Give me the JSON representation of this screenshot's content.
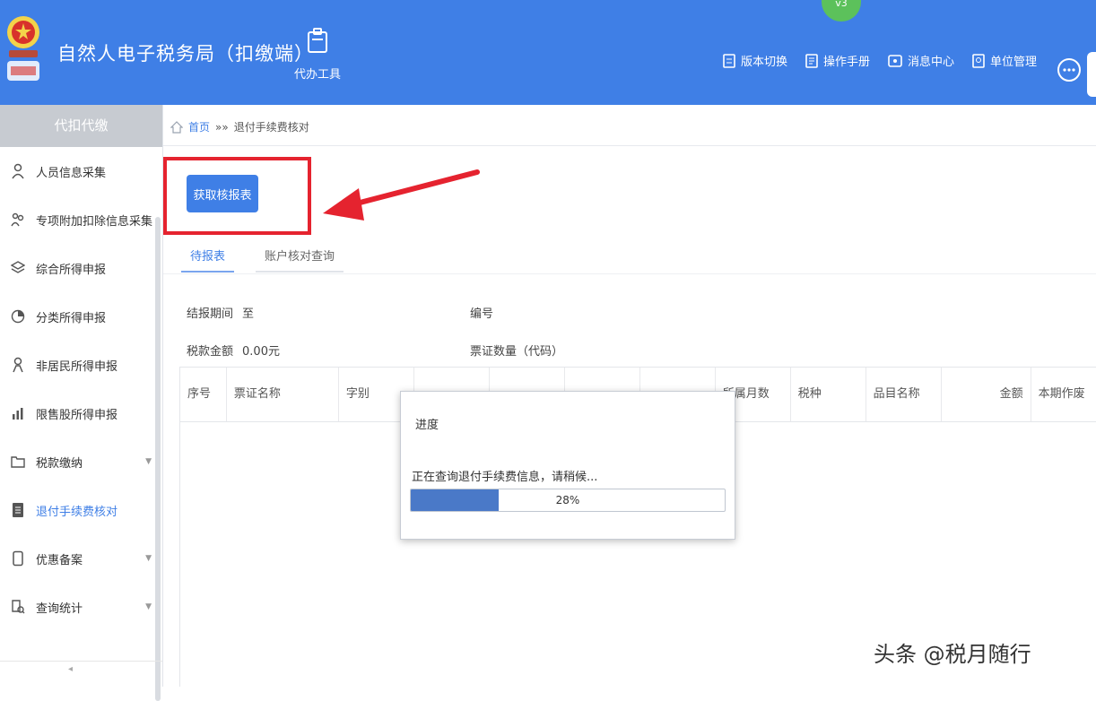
{
  "header": {
    "app_title": "自然人电子税务局（扣缴端）",
    "agent_tool_label": "代办工具",
    "badge_text": "v3",
    "actions": [
      {
        "label": "版本切换",
        "icon": "switch-icon"
      },
      {
        "label": "操作手册",
        "icon": "manual-icon"
      },
      {
        "label": "消息中心",
        "icon": "message-icon"
      },
      {
        "label": "单位管理",
        "icon": "org-icon"
      }
    ],
    "colors": {
      "bar": "#3f7fe6",
      "badge": "#5cc15b"
    }
  },
  "sidebar": {
    "title": "代扣代缴",
    "items": [
      {
        "label": "人员信息采集",
        "icon": "person-icon"
      },
      {
        "label": "专项附加扣除信息采集",
        "icon": "family-icon"
      },
      {
        "label": "综合所得申报",
        "icon": "layers-icon"
      },
      {
        "label": "分类所得申报",
        "icon": "pie-icon"
      },
      {
        "label": "非居民所得申报",
        "icon": "user-icon"
      },
      {
        "label": "限售股所得申报",
        "icon": "chart-icon"
      },
      {
        "label": "税款缴纳",
        "icon": "folder-icon"
      },
      {
        "label": "退付手续费核对",
        "icon": "doc-icon"
      },
      {
        "label": "优惠备案",
        "icon": "file-icon"
      },
      {
        "label": "查询统计",
        "icon": "search-doc-icon"
      }
    ],
    "active_index": 7
  },
  "breadcrumb": {
    "home": "首页",
    "sep": "»»",
    "current": "退付手续费核对"
  },
  "main": {
    "fetch_button": "获取核报表",
    "tabs": [
      "待报表",
      "账户核对查询"
    ],
    "fields": {
      "period_label": "结报期间",
      "period_value": "至",
      "amount_label": "税款金额",
      "amount_value": "0.00元",
      "number_label": "编号",
      "count_label": "票证数量（代码）"
    },
    "columns": [
      "序号",
      "票证名称",
      "字别",
      "",
      "",
      "",
      "",
      "所属月数",
      "税种",
      "品目名称",
      "金额",
      "本期作废"
    ]
  },
  "dialog": {
    "title": "进度",
    "message": "正在查询退付手续费信息，请稍候...",
    "progress_text": "28%",
    "progress_value": 0.28,
    "fill_color": "#4a79c8"
  },
  "watermark": "头条 @税月随行",
  "annotation_color": "#e5232f"
}
